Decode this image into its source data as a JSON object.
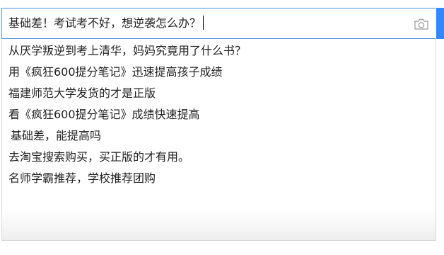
{
  "search": {
    "query": "基础差！考试考不好，想逆袭怎么办？",
    "camera_icon": "camera-icon"
  },
  "suggestions": [
    "从厌学叛逆到考上清华，妈妈究竟用了什么书？",
    "用《疯狂600提分笔记》迅速提高孩子成绩",
    "福建师范大学发货的才是正版",
    "看《疯狂600提分笔记》成绩快速提高",
    "基础差，能提高吗",
    "去淘宝搜索购买，买正版的才有用。",
    "名师学霸推荐，学校推荐团购"
  ],
  "colors": {
    "accent": "#3388ff",
    "border": "#4a90e2"
  }
}
